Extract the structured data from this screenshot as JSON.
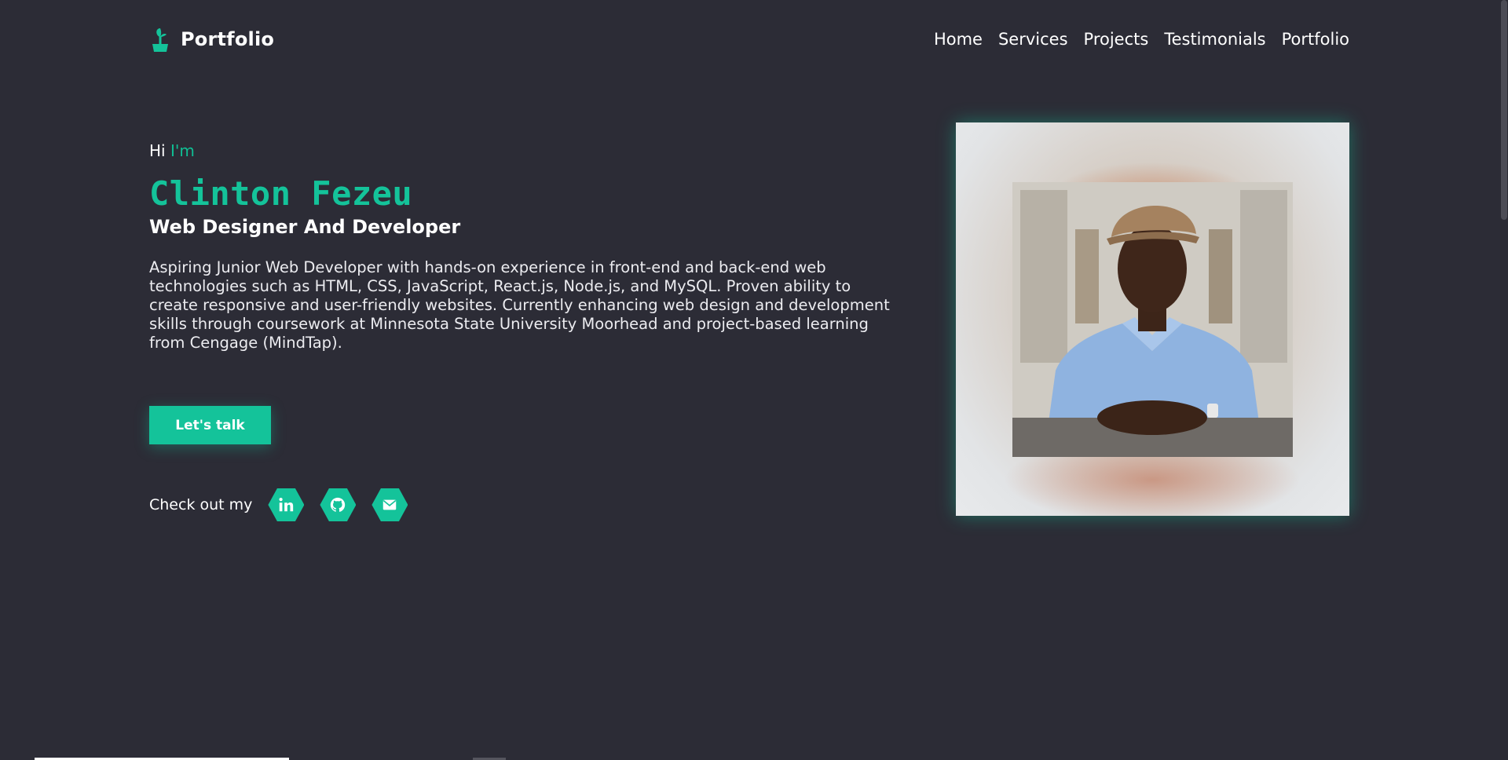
{
  "header": {
    "brand": "Portfolio",
    "nav": [
      "Home",
      "Services",
      "Projects",
      "Testimonials",
      "Portfolio"
    ]
  },
  "hero": {
    "greeting_hi": "Hi",
    "greeting_im": "I'm",
    "name": "Clinton Fezeu",
    "role": "Web Designer And Developer",
    "bio": "Aspiring Junior Web Developer with hands-on experience in front-end and back-end web technologies such as HTML, CSS, JavaScript, React.js, Node.js, and MySQL. Proven ability to create responsive and user-friendly websites. Currently enhancing web design and development skills through coursework at Minnesota State University Moorhead and project-based learning from Cengage (MindTap).",
    "cta_label": "Let's talk",
    "socials_label": "Check out my",
    "socials": [
      {
        "icon": "linkedin-icon"
      },
      {
        "icon": "github-icon"
      },
      {
        "icon": "email-icon"
      }
    ]
  },
  "colors": {
    "background": "#2c2c36",
    "accent": "#14c39a",
    "text": "#ffffff"
  }
}
